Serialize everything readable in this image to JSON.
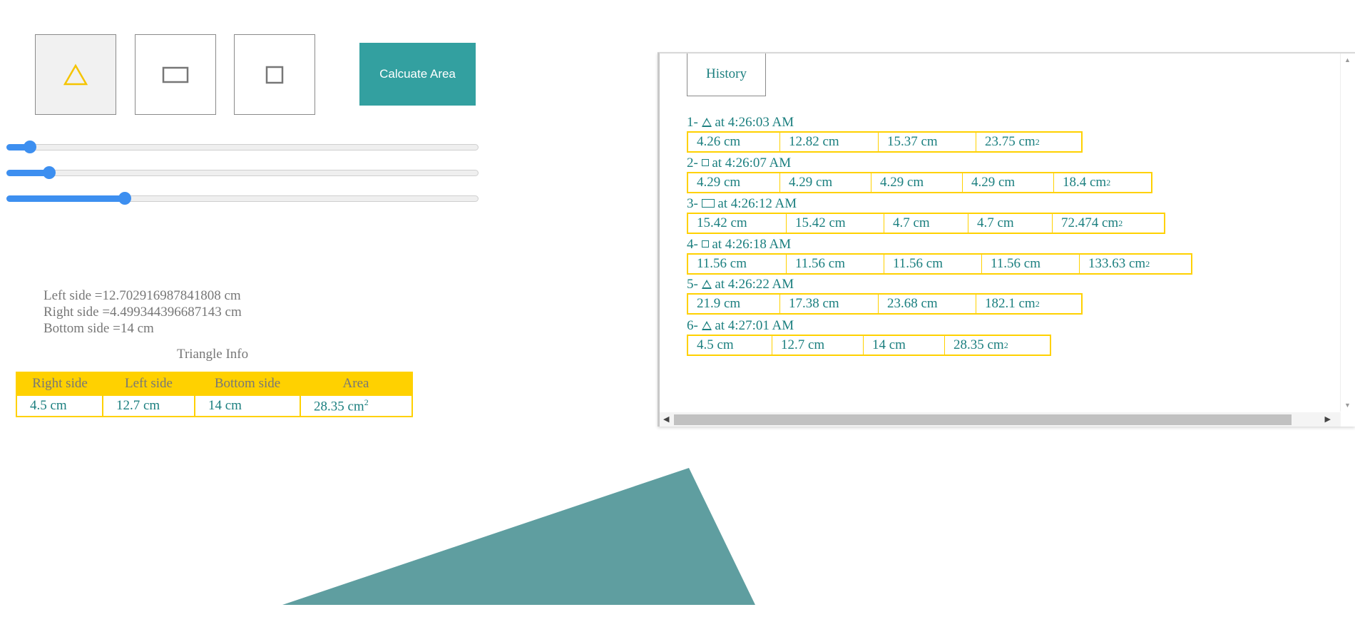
{
  "toolbar": {
    "shapes": [
      {
        "name": "triangle",
        "icon": "triangle-icon",
        "active": true
      },
      {
        "name": "rectangle",
        "icon": "rectangle-icon",
        "active": false
      },
      {
        "name": "square",
        "icon": "square-icon",
        "active": false
      }
    ],
    "calc_label": "Calcuate Area"
  },
  "sliders": [
    {
      "name": "slider-1",
      "fraction": 0.05
    },
    {
      "name": "slider-2",
      "fraction": 0.09
    },
    {
      "name": "slider-3",
      "fraction": 0.25
    }
  ],
  "sides": {
    "left": "Left side =12.702916987841808 cm",
    "right": "Right side =4.499344396687143 cm",
    "bottom": "Bottom side =14 cm"
  },
  "info": {
    "title": "Triangle Info",
    "headers": [
      "Right side",
      "Left side",
      "Bottom side",
      "Area"
    ],
    "values": [
      "4.5 cm",
      "12.7 cm",
      "14 cm",
      "28.35 cm"
    ],
    "area_unit_sup": "2"
  },
  "history": {
    "button_label": "History",
    "entries": [
      {
        "index": "1-",
        "shape": "triangle",
        "time": "at 4:26:03 AM",
        "cells": [
          "4.26 cm",
          "12.82 cm",
          "15.37 cm"
        ],
        "area": "23.75 cm"
      },
      {
        "index": "2-",
        "shape": "square",
        "time": "at 4:26:07 AM",
        "cells": [
          "4.29 cm",
          "4.29 cm",
          "4.29 cm",
          "4.29 cm"
        ],
        "area": "18.4 cm"
      },
      {
        "index": "3-",
        "shape": "rectangle",
        "time": "at 4:26:12 AM",
        "cells": [
          "15.42 cm",
          "15.42 cm",
          "4.7 cm",
          "4.7 cm"
        ],
        "area": "72.474 cm"
      },
      {
        "index": "4-",
        "shape": "square",
        "time": "at 4:26:18 AM",
        "cells": [
          "11.56 cm",
          "11.56 cm",
          "11.56 cm",
          "11.56 cm"
        ],
        "area": "133.63 cm"
      },
      {
        "index": "5-",
        "shape": "triangle",
        "time": "at 4:26:22 AM",
        "cells": [
          "21.9 cm",
          "17.38 cm",
          "23.68 cm"
        ],
        "area": "182.1 cm"
      },
      {
        "index": "6-",
        "shape": "triangle",
        "time": "at 4:27:01 AM",
        "cells": [
          "4.5 cm",
          "12.7 cm",
          "14 cm"
        ],
        "area": "28.35 cm"
      }
    ]
  },
  "colors": {
    "accent": "#33a0a0",
    "shape_fill": "#5f9ea0",
    "table_border": "#ffd100",
    "text_teal": "#1b7f7f",
    "slider": "#3d8ff0"
  }
}
